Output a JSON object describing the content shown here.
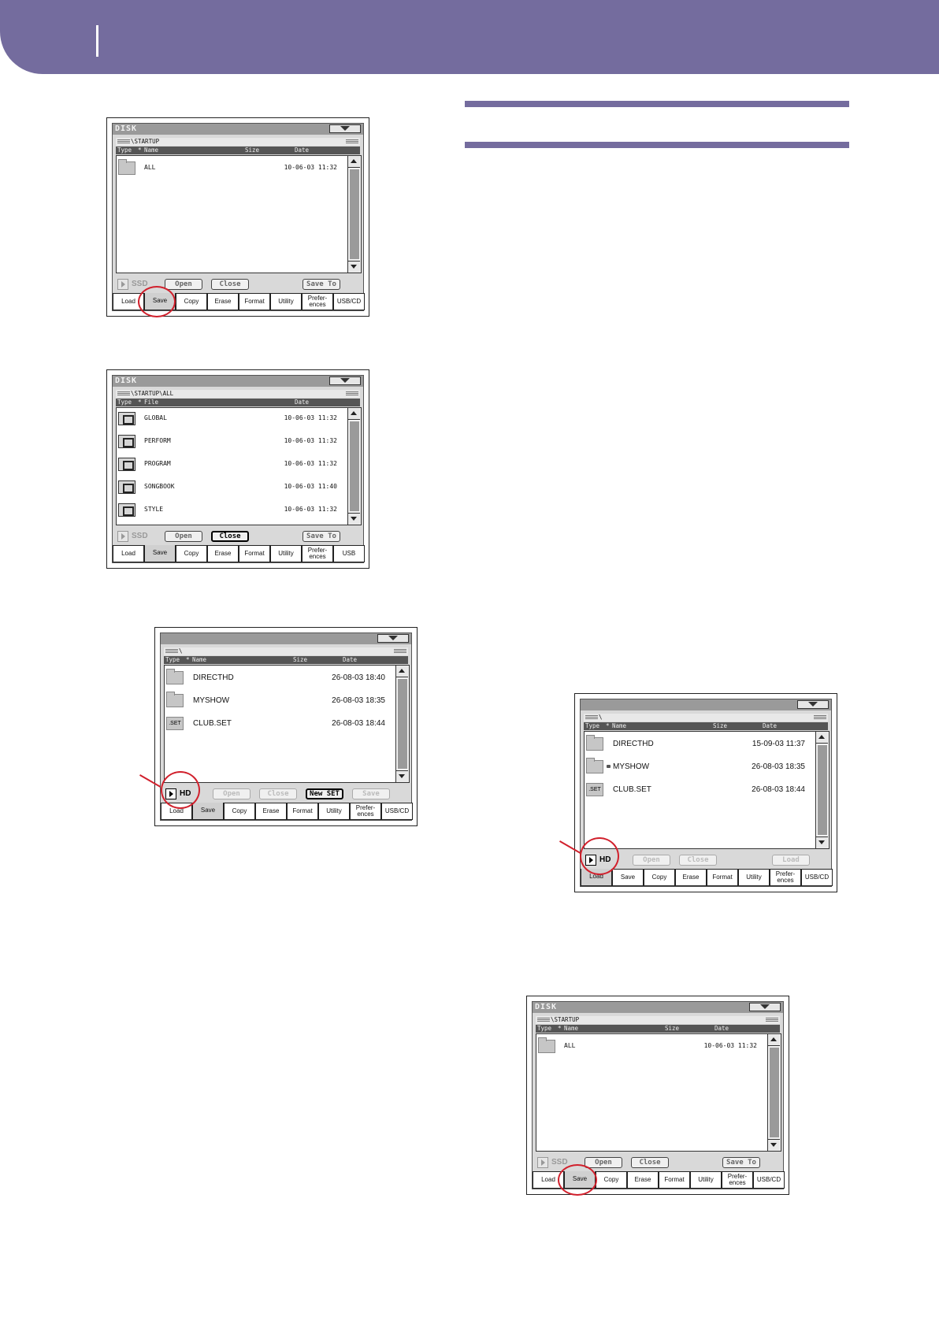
{
  "screens": [
    {
      "id": "s1",
      "title": "DISK",
      "path": "\\STARTUP",
      "columns": [
        "Type",
        "*",
        "Name",
        "Size",
        "Date"
      ],
      "rows": [
        {
          "icon": "folder-icon",
          "name": "ALL",
          "date": "10-06-03 11:32"
        }
      ],
      "device": "SSD",
      "buttons": [
        "Open",
        "Close",
        "Save To"
      ],
      "tabs": [
        "Load",
        "Save",
        "Copy",
        "Erase",
        "Format",
        "Utility",
        "Prefer-",
        "ences",
        "USB/CD"
      ],
      "selected_tab": "Save"
    },
    {
      "id": "s2",
      "title": "DISK",
      "path": "\\STARTUP\\ALL",
      "columns": [
        "Type",
        "*",
        "File",
        "Date"
      ],
      "rows": [
        {
          "icon": "global-file-icon",
          "name": "GLOBAL",
          "date": "10-06-03 11:32"
        },
        {
          "icon": "perform-file-icon",
          "name": "PERFORM",
          "date": "10-06-03 11:32"
        },
        {
          "icon": "program-file-icon",
          "name": "PROGRAM",
          "date": "10-06-03 11:32"
        },
        {
          "icon": "songbook-file-icon",
          "name": "SONGBOOK",
          "date": "10-06-03 11:40"
        },
        {
          "icon": "style-file-icon",
          "name": "STYLE",
          "date": "10-06-03 11:32"
        }
      ],
      "device": "SSD",
      "buttons": [
        "Open",
        "Close",
        "Save To"
      ],
      "tabs": [
        "Load",
        "Save",
        "Copy",
        "Erase",
        "Format",
        "Utility",
        "Prefer-",
        "ences",
        "USB"
      ],
      "selected_tab": "Save"
    },
    {
      "id": "s3",
      "title": "",
      "path": "\\",
      "columns": [
        "Type",
        "*",
        "Name",
        "Size",
        "Date"
      ],
      "rows": [
        {
          "icon": "folder-icon",
          "name": "DIRECTHD",
          "date": "26-08-03 18:40"
        },
        {
          "icon": "folder-icon",
          "name": "MYSHOW",
          "date": "26-08-03 18:35"
        },
        {
          "icon": "set-icon",
          "icon_text": ".SET",
          "name": "CLUB.SET",
          "date": "26-08-03 18:44"
        }
      ],
      "device": "HD",
      "buttons": [
        "Open",
        "Close",
        "New SET",
        "Save"
      ],
      "tabs": [
        "Load",
        "Save",
        "Copy",
        "Erase",
        "Format",
        "Utility",
        "Prefer-",
        "ences",
        "USB/CD"
      ],
      "selected_tab": "Save"
    },
    {
      "id": "s4",
      "title": "",
      "path": "\\",
      "columns": [
        "Type",
        "*",
        "Name",
        "Size",
        "Date"
      ],
      "rows": [
        {
          "icon": "folder-icon",
          "name": "DIRECTHD",
          "date": "15-09-03 11:37"
        },
        {
          "icon": "folder-icon",
          "name": "MYSHOW",
          "date": "26-08-03 18:35",
          "locked": true
        },
        {
          "icon": "set-icon",
          "icon_text": ".SET",
          "name": "CLUB.SET",
          "date": "26-08-03 18:44"
        }
      ],
      "device": "HD",
      "buttons": [
        "Open",
        "Close",
        "Load"
      ],
      "tabs": [
        "Load",
        "Save",
        "Copy",
        "Erase",
        "Format",
        "Utility",
        "Prefer-",
        "ences",
        "USB/CD"
      ],
      "selected_tab": "Load"
    },
    {
      "id": "s5",
      "title": "DISK",
      "path": "\\STARTUP",
      "columns": [
        "Type",
        "*",
        "Name",
        "Size",
        "Date"
      ],
      "rows": [
        {
          "icon": "folder-icon",
          "name": "ALL",
          "date": "10-06-03 11:32"
        }
      ],
      "device": "SSD",
      "buttons": [
        "Open",
        "Close",
        "Save To"
      ],
      "tabs": [
        "Load",
        "Save",
        "Copy",
        "Erase",
        "Format",
        "Utility",
        "Prefer-",
        "ences",
        "USB/CD"
      ],
      "selected_tab": "Save"
    }
  ],
  "colors": {
    "band": "#746c9e",
    "highlight": "#d1202c"
  }
}
